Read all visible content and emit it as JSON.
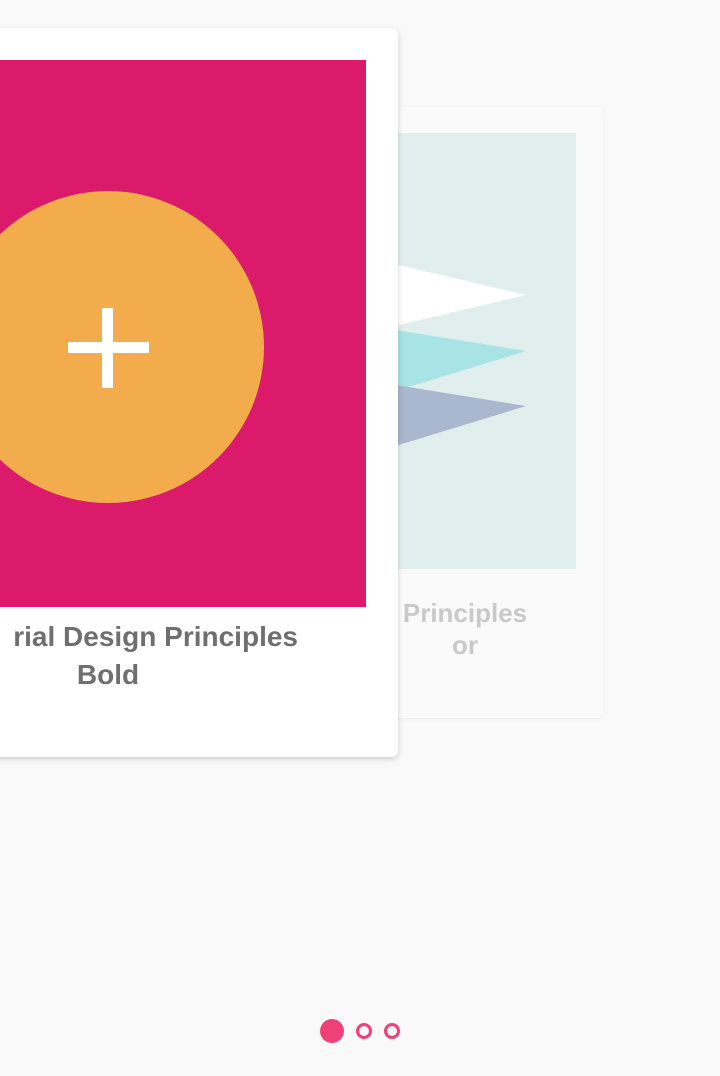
{
  "pager": {
    "cards": [
      {
        "title_line1": "rial Design Principles",
        "title_line2": "Bold",
        "art_background": "#dc1a6c",
        "art_circle_color": "#f2ac4c",
        "art_icon": "plus-icon"
      },
      {
        "title_line1": "Principles",
        "title_line2": "or",
        "art_background": "#e0efed",
        "art_icon": "layered-triangles-icon"
      }
    ]
  },
  "indicators": {
    "count": 3,
    "active_index": 0,
    "color": "#f0407a"
  }
}
